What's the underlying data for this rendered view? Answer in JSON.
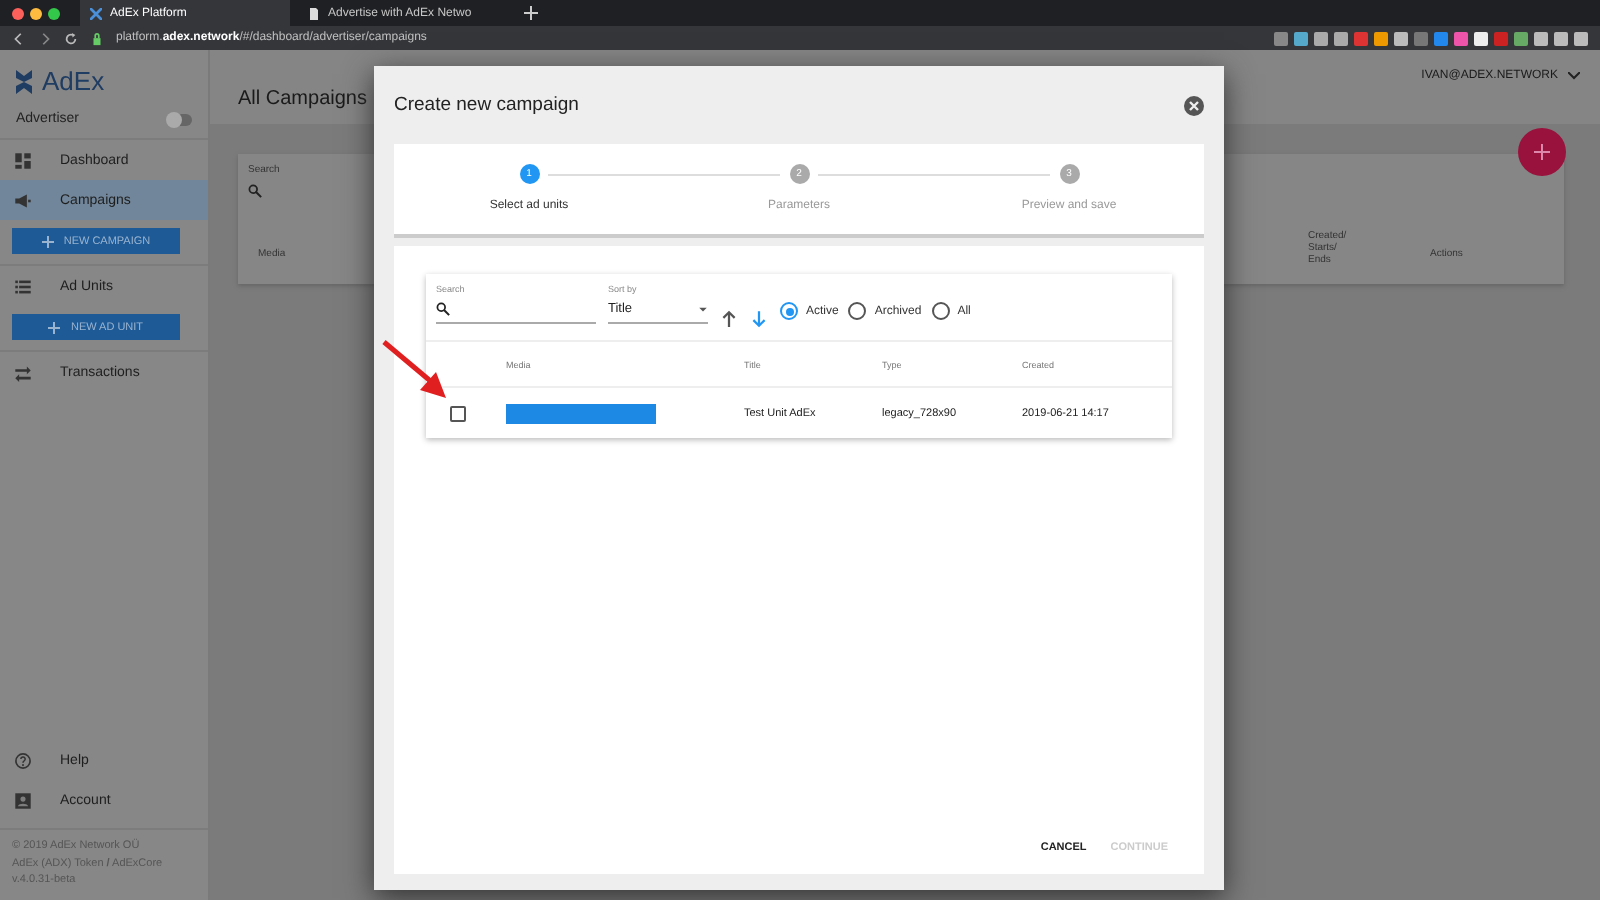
{
  "browser": {
    "tabs": [
      {
        "title": "AdEx Platform",
        "selected": true
      },
      {
        "title": "Advertise with AdEx Netwo",
        "selected": false
      }
    ],
    "url": "platform.**adex.network**/#/dashboard/advertiser/campaigns"
  },
  "sidebar": {
    "logo": "AdEx",
    "role": {
      "label": "Advertiser",
      "on": false
    },
    "items": [
      {
        "kind": "link",
        "label": "Dashboard",
        "selected": false
      },
      {
        "kind": "link",
        "label": "Campaigns",
        "selected": true
      },
      {
        "kind": "button",
        "label": "NEW CAMPAIGN",
        "selected": false
      },
      {
        "kind": "link",
        "label": "Ad Units",
        "selected": false
      },
      {
        "kind": "button",
        "label": "NEW AD UNIT",
        "selected": false
      },
      {
        "kind": "link",
        "label": "Transactions",
        "selected": false
      }
    ],
    "bottom": [
      {
        "label": "Help"
      },
      {
        "label": "Account"
      }
    ],
    "footer": [
      "© 2019  AdEx Network OÜ",
      "AdEx (ADX) Token **/** AdExCore",
      "v.4.0.31-beta"
    ]
  },
  "page": {
    "title": "All Campaigns",
    "user": "IVAN@ADEX.NETWORK",
    "table": {
      "search_label": "Search",
      "columns": [
        "Media",
        "Created/ Starts/ Ends",
        "Actions"
      ]
    }
  },
  "modal": {
    "title": "Create new campaign",
    "steps": [
      {
        "number": "1",
        "label": "Select ad units",
        "selected": true
      },
      {
        "number": "2",
        "label": "Parameters",
        "selected": false
      },
      {
        "number": "3",
        "label": "Preview and save",
        "selected": false
      }
    ],
    "filters": {
      "search_label": "Search",
      "sort_label": "Sort by",
      "sort_value": "Title",
      "sort_descending": true,
      "status": [
        {
          "label": "Active",
          "selected": true
        },
        {
          "label": "Archived",
          "selected": false
        },
        {
          "label": "All",
          "selected": false
        }
      ]
    },
    "table": {
      "columns": [
        "Media",
        "Title",
        "Type",
        "Created"
      ],
      "rows": [
        {
          "checked": false,
          "title": "Test Unit AdEx",
          "type": "legacy_728x90",
          "created": "2019-06-21 14:17"
        }
      ]
    },
    "buttons": [
      {
        "label": "CANCEL",
        "disabled": false
      },
      {
        "label": "CONTINUE",
        "disabled": true
      }
    ]
  }
}
